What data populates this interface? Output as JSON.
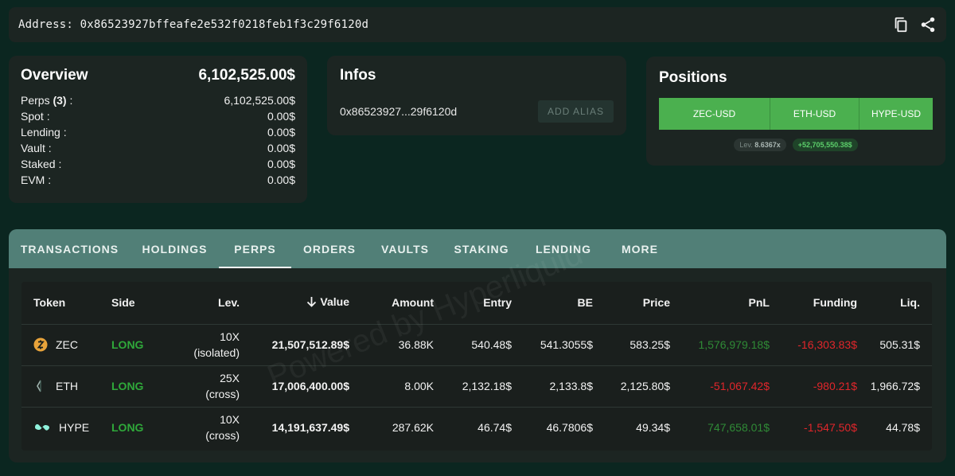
{
  "header": {
    "address_label": "Address:",
    "address": "0x86523927bffeafe2e532f0218feb1f3c29f6120d",
    "copy_icon": "copy-icon",
    "share_icon": "share-icon"
  },
  "overview": {
    "title": "Overview",
    "total": "6,102,525.00$",
    "perps_label": "Perps",
    "perps_count": "(3)",
    "perps_suffix": ":",
    "rows": [
      {
        "label": "Perps (3) :",
        "value": "6,102,525.00$"
      },
      {
        "label": "Spot :",
        "value": "0.00$"
      },
      {
        "label": "Lending :",
        "value": "0.00$"
      },
      {
        "label": "Vault :",
        "value": "0.00$"
      },
      {
        "label": "Staked :",
        "value": "0.00$"
      },
      {
        "label": "EVM :",
        "value": "0.00$"
      }
    ]
  },
  "infos": {
    "title": "Infos",
    "short_address": "0x86523927...29f6120d",
    "add_alias_label": "ADD ALIAS"
  },
  "positions": {
    "title": "Positions",
    "tabs": [
      "ZEC-USD",
      "ETH-USD",
      "HYPE-USD"
    ],
    "lev_label": "Lev.",
    "lev_value": "8.6367x",
    "pnl": "+52,705,550.38$"
  },
  "tabs": [
    "TRANSACTIONS",
    "HOLDINGS",
    "PERPS",
    "ORDERS",
    "VAULTS",
    "STAKING",
    "LENDING",
    "MORE"
  ],
  "active_tab": "PERPS",
  "table": {
    "headers": [
      "Token",
      "Side",
      "Lev.",
      "Value",
      "Amount",
      "Entry",
      "BE",
      "Price",
      "PnL",
      "Funding",
      "Liq."
    ],
    "rows": [
      {
        "token": "ZEC",
        "side": "LONG",
        "lev": "10X",
        "lev_mode": "(isolated)",
        "value": "21,507,512.89$",
        "amount": "36.88K",
        "entry": "540.48$",
        "be": "541.3055$",
        "price": "583.25$",
        "pnl": "1,576,979.18$",
        "funding": "-16,303.83$",
        "liq": "505.31$"
      },
      {
        "token": "ETH",
        "side": "LONG",
        "lev": "25X",
        "lev_mode": "(cross)",
        "value": "17,006,400.00$",
        "amount": "8.00K",
        "entry": "2,132.18$",
        "be": "2,133.8$",
        "price": "2,125.80$",
        "pnl": "-51,067.42$",
        "funding": "-980.21$",
        "liq": "1,966.72$"
      },
      {
        "token": "HYPE",
        "side": "LONG",
        "lev": "10X",
        "lev_mode": "(cross)",
        "value": "14,191,637.49$",
        "amount": "287.62K",
        "entry": "46.74$",
        "be": "46.7806$",
        "price": "49.34$",
        "pnl": "747,658.01$",
        "funding": "-1,547.50$",
        "liq": "44.78$"
      }
    ]
  },
  "watermark": "Powered by Hyperliquid",
  "colors": {
    "background": "#0b2620",
    "card": "#1c2522",
    "tab_bar": "#517f77",
    "long_green": "#2fa83a",
    "negative_red": "#e0262b",
    "position_tab_green": "#4bb04f"
  }
}
